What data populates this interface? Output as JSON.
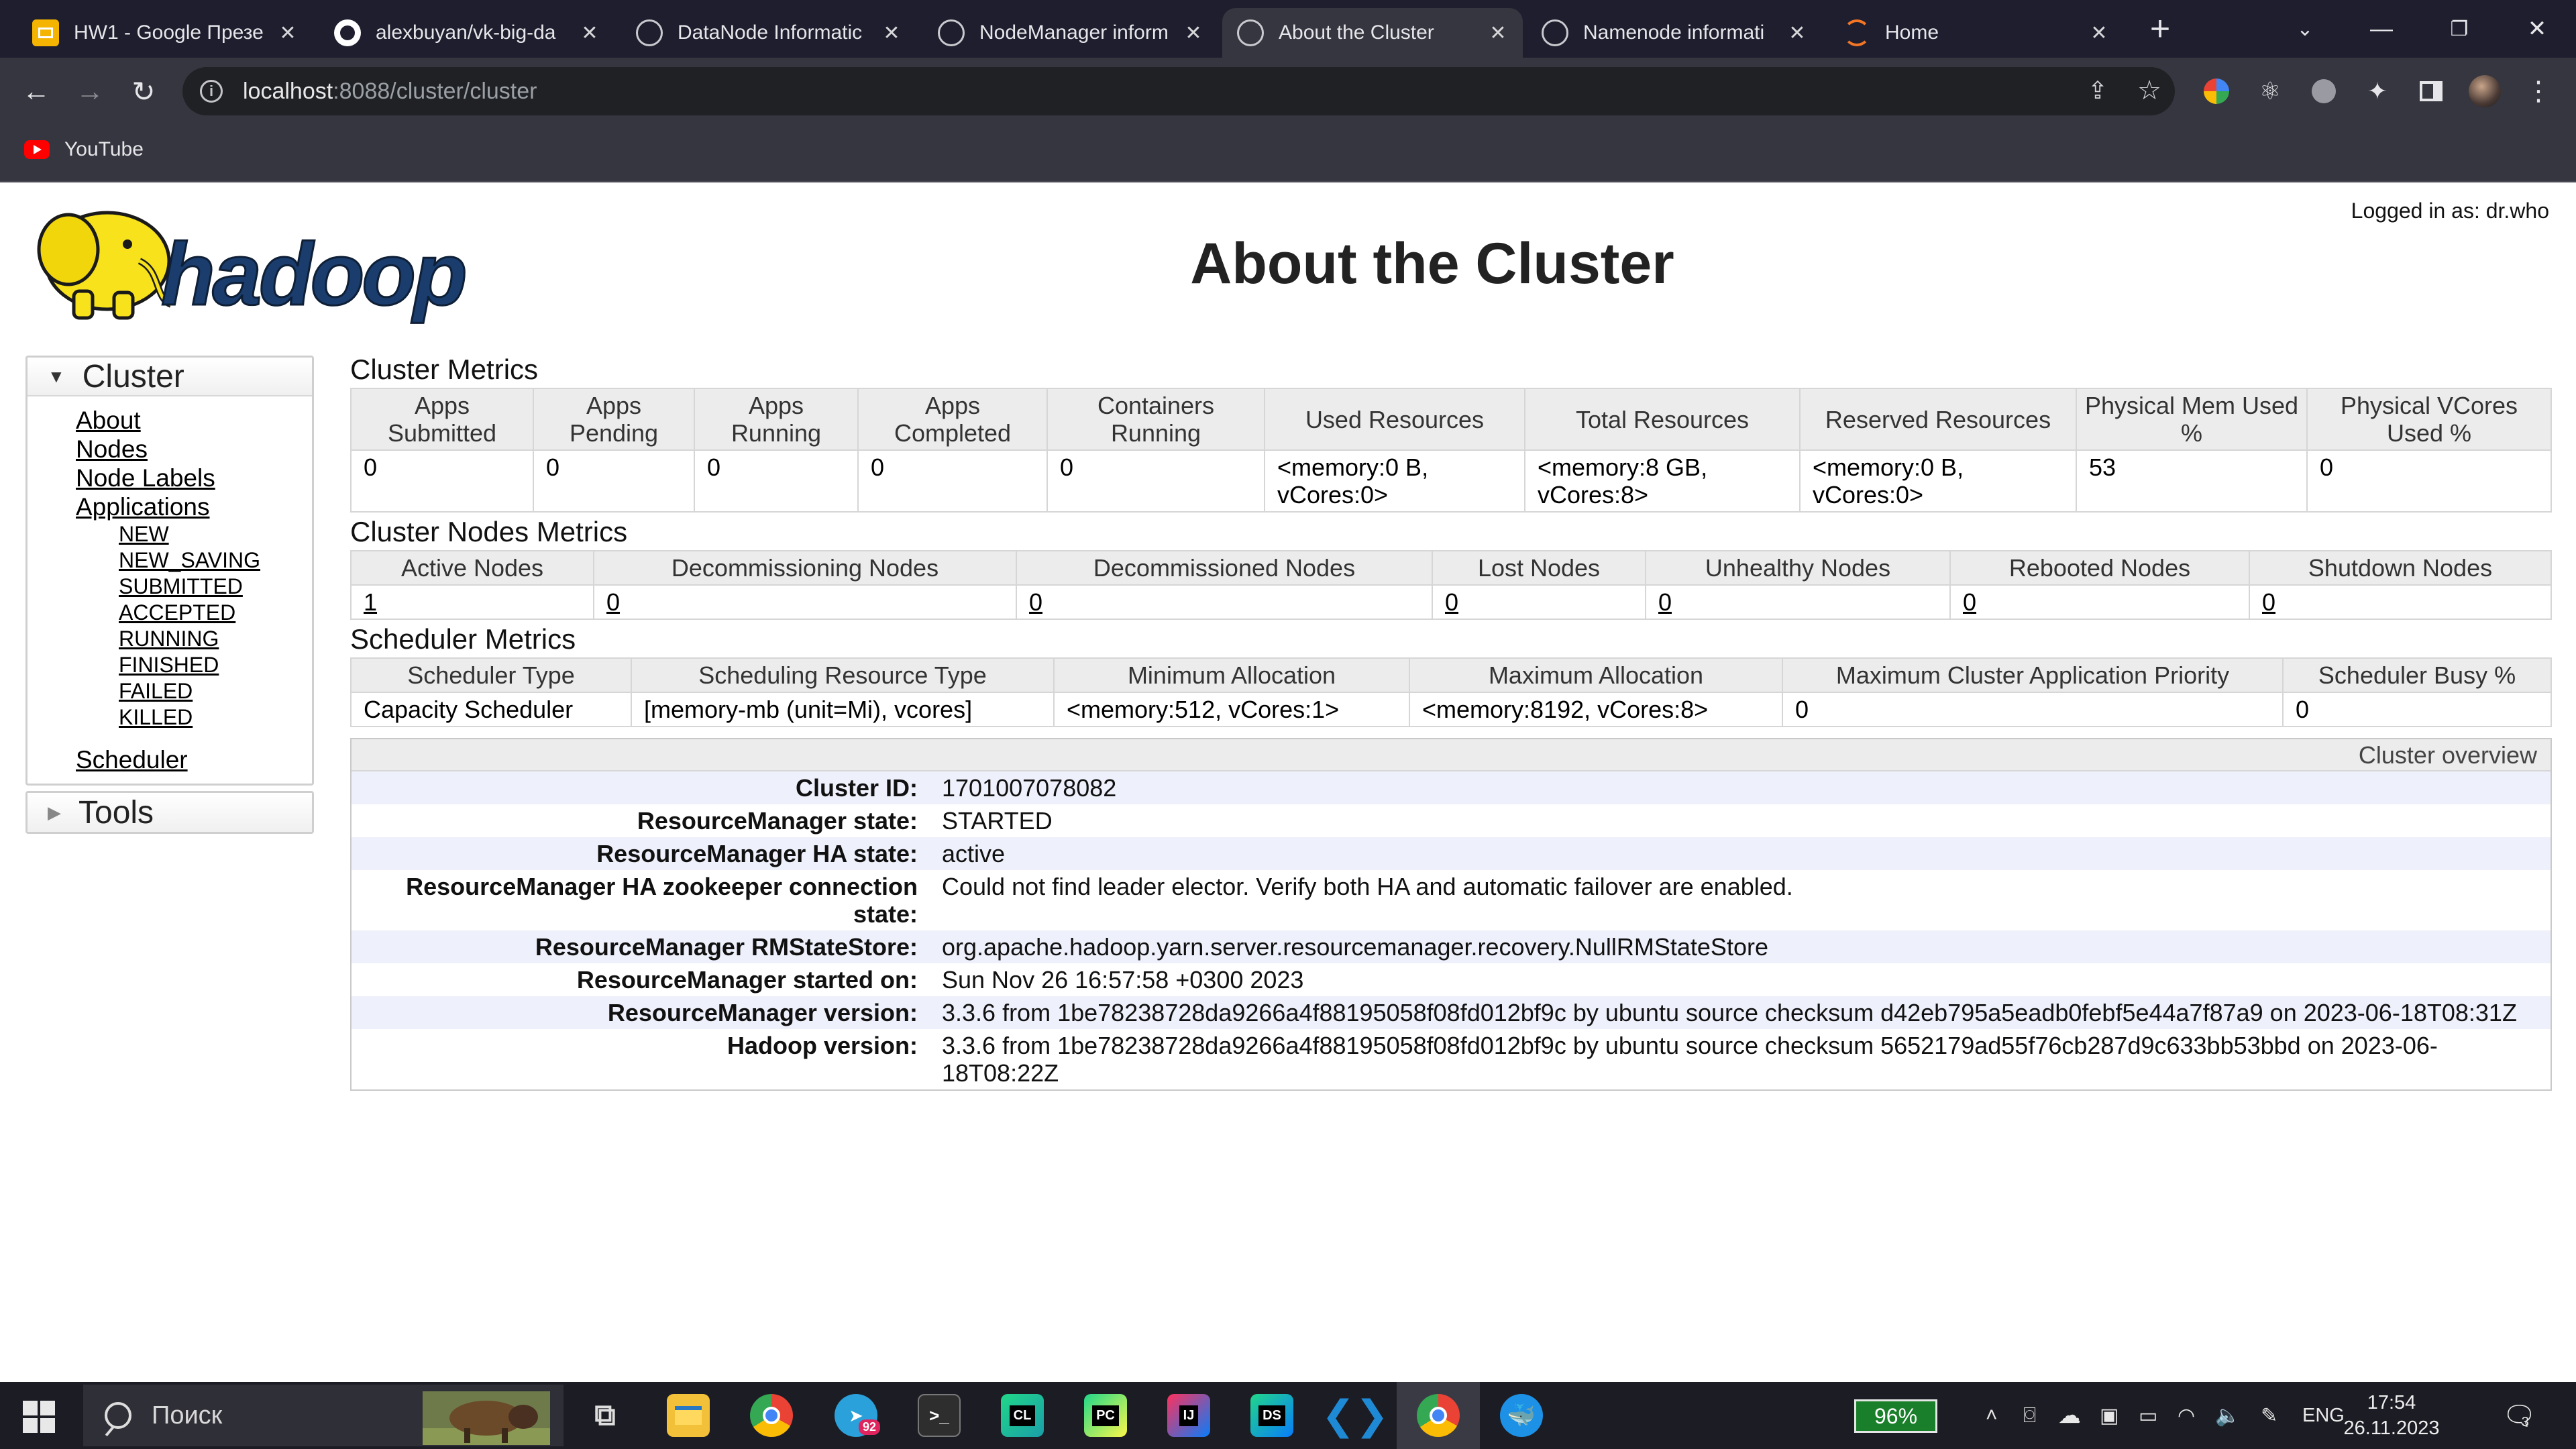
{
  "browser": {
    "tabs": [
      {
        "title": "HW1 - Google Презе",
        "icon": "google-slides-icon"
      },
      {
        "title": "alexbuyan/vk-big-da",
        "icon": "github-icon"
      },
      {
        "title": "DataNode Informatic",
        "icon": "globe-icon"
      },
      {
        "title": "NodeManager inform",
        "icon": "globe-icon"
      },
      {
        "title": "About the Cluster",
        "icon": "globe-icon",
        "active": true
      },
      {
        "title": "Namenode informati",
        "icon": "globe-icon"
      },
      {
        "title": "Home",
        "icon": "jupyter-icon"
      }
    ],
    "url_host": "localhost",
    "url_path": ":8088/cluster/cluster",
    "bookmark": "YouTube"
  },
  "page": {
    "title": "About the Cluster",
    "logged_in": "Logged in as: dr.who"
  },
  "nav": {
    "cluster_label": "Cluster",
    "links": [
      "About",
      "Nodes",
      "Node Labels",
      "Applications"
    ],
    "app_states": [
      "NEW",
      "NEW_SAVING",
      "SUBMITTED",
      "ACCEPTED",
      "RUNNING",
      "FINISHED",
      "FAILED",
      "KILLED"
    ],
    "scheduler": "Scheduler",
    "tools_label": "Tools"
  },
  "cluster_metrics": {
    "title": "Cluster Metrics",
    "headers": [
      "Apps Submitted",
      "Apps Pending",
      "Apps Running",
      "Apps Completed",
      "Containers Running",
      "Used Resources",
      "Total Resources",
      "Reserved Resources",
      "Physical Mem Used %",
      "Physical VCores Used %"
    ],
    "values": [
      "0",
      "0",
      "0",
      "0",
      "0",
      "<memory:0 B, vCores:0>",
      "<memory:8 GB, vCores:8>",
      "<memory:0 B, vCores:0>",
      "53",
      "0"
    ]
  },
  "node_metrics": {
    "title": "Cluster Nodes Metrics",
    "headers": [
      "Active Nodes",
      "Decommissioning Nodes",
      "Decommissioned Nodes",
      "Lost Nodes",
      "Unhealthy Nodes",
      "Rebooted Nodes",
      "Shutdown Nodes"
    ],
    "values": [
      "1",
      "0",
      "0",
      "0",
      "0",
      "0",
      "0"
    ]
  },
  "scheduler_metrics": {
    "title": "Scheduler Metrics",
    "headers": [
      "Scheduler Type",
      "Scheduling Resource Type",
      "Minimum Allocation",
      "Maximum Allocation",
      "Maximum Cluster Application Priority",
      "Scheduler Busy %"
    ],
    "values": [
      "Capacity Scheduler",
      "[memory-mb (unit=Mi), vcores]",
      "<memory:512, vCores:1>",
      "<memory:8192, vCores:8>",
      "0",
      "0"
    ]
  },
  "overview": {
    "title": "Cluster overview",
    "rows": [
      {
        "k": "Cluster ID:",
        "v": "1701007078082"
      },
      {
        "k": "ResourceManager state:",
        "v": "STARTED"
      },
      {
        "k": "ResourceManager HA state:",
        "v": "active"
      },
      {
        "k": "ResourceManager HA zookeeper connection state:",
        "v": "Could not find leader elector. Verify both HA and automatic failover are enabled."
      },
      {
        "k": "ResourceManager RMStateStore:",
        "v": "org.apache.hadoop.yarn.server.resourcemanager.recovery.NullRMStateStore"
      },
      {
        "k": "ResourceManager started on:",
        "v": "Sun Nov 26 16:57:58 +0300 2023"
      },
      {
        "k": "ResourceManager version:",
        "v": "3.3.6 from 1be78238728da9266a4f88195058f08fd012bf9c by ubuntu source checksum d42eb795a5eadb0febf5e44a7f87a9 on 2023-06-18T08:31Z"
      },
      {
        "k": "Hadoop version:",
        "v": "3.3.6 from 1be78238728da9266a4f88195058f08fd012bf9c by ubuntu source checksum 5652179ad55f76cb287d9c633bb53bbd on 2023-06-18T08:22Z"
      }
    ]
  },
  "taskbar": {
    "search_placeholder": "Поиск",
    "telegram_badge": "92",
    "battery": "96%",
    "lang": "ENG",
    "time": "17:54",
    "date": "26.11.2023",
    "notifications": "3"
  }
}
